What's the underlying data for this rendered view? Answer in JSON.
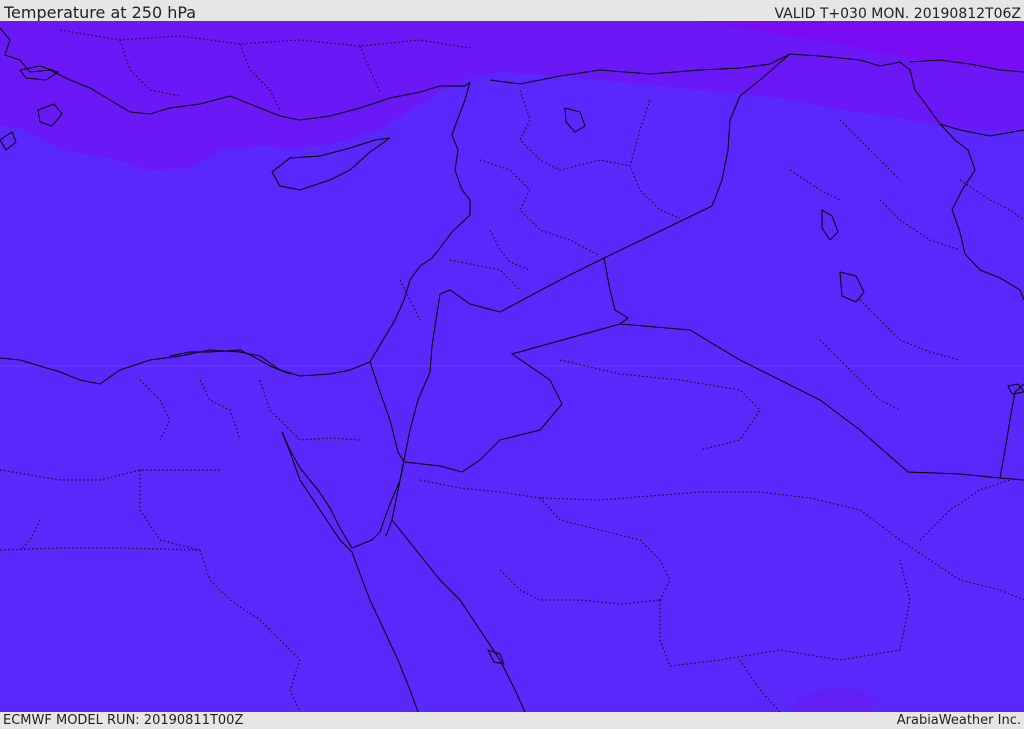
{
  "header": {
    "title": "Temperature at 250 hPa",
    "valid": "VALID T+030 MON. 20190812T06Z"
  },
  "footer": {
    "model_run": "ECMWF MODEL RUN: 20190811T00Z",
    "credit": "ArabiaWeather Inc."
  },
  "map": {
    "fill_colors": {
      "base": "#5a28fa",
      "colder_band": "#6b18f6",
      "coldest_band": "#7a0cf4",
      "warm_patch": "#5d22f7"
    },
    "border_color": "#000000"
  }
}
